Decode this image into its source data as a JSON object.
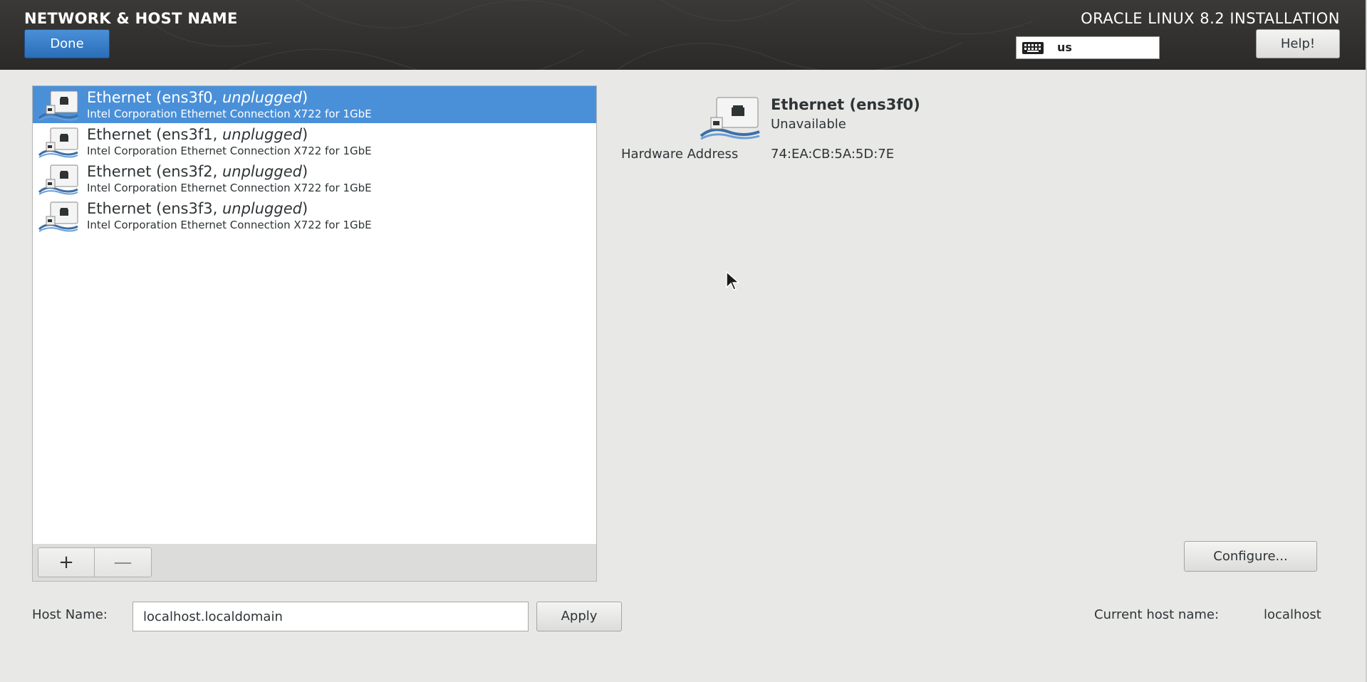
{
  "header": {
    "spoke_title": "NETWORK & HOST NAME",
    "done_label": "Done",
    "product_title": "ORACLE LINUX 8.2 INSTALLATION",
    "keyboard_layout": "us",
    "help_label": "Help!"
  },
  "devices": [
    {
      "name": "Ethernet (ens3f0, ",
      "state": "unplugged",
      "close": ")",
      "description": "Intel Corporation Ethernet Connection X722 for 1GbE",
      "selected": true
    },
    {
      "name": "Ethernet (ens3f1, ",
      "state": "unplugged",
      "close": ")",
      "description": "Intel Corporation Ethernet Connection X722 for 1GbE",
      "selected": false
    },
    {
      "name": "Ethernet (ens3f2, ",
      "state": "unplugged",
      "close": ")",
      "description": "Intel Corporation Ethernet Connection X722 for 1GbE",
      "selected": false
    },
    {
      "name": "Ethernet (ens3f3, ",
      "state": "unplugged",
      "close": ")",
      "description": "Intel Corporation Ethernet Connection X722 for 1GbE",
      "selected": false
    }
  ],
  "list_toolbar": {
    "add_label": "+",
    "remove_label": "—"
  },
  "detail": {
    "name": "Ethernet (ens3f0)",
    "status": "Unavailable",
    "hw_address_label": "Hardware Address",
    "hw_address": "74:EA:CB:5A:5D:7E",
    "configure_label": "Configure..."
  },
  "hostname": {
    "label": "Host Name:",
    "value": "localhost.localdomain",
    "apply_label": "Apply",
    "current_label": "Current host name:",
    "current_value": "localhost"
  },
  "colors": {
    "accent": "#4a90d9",
    "header_bg": "#2f2e2c",
    "body_bg": "#e8e8e7"
  }
}
